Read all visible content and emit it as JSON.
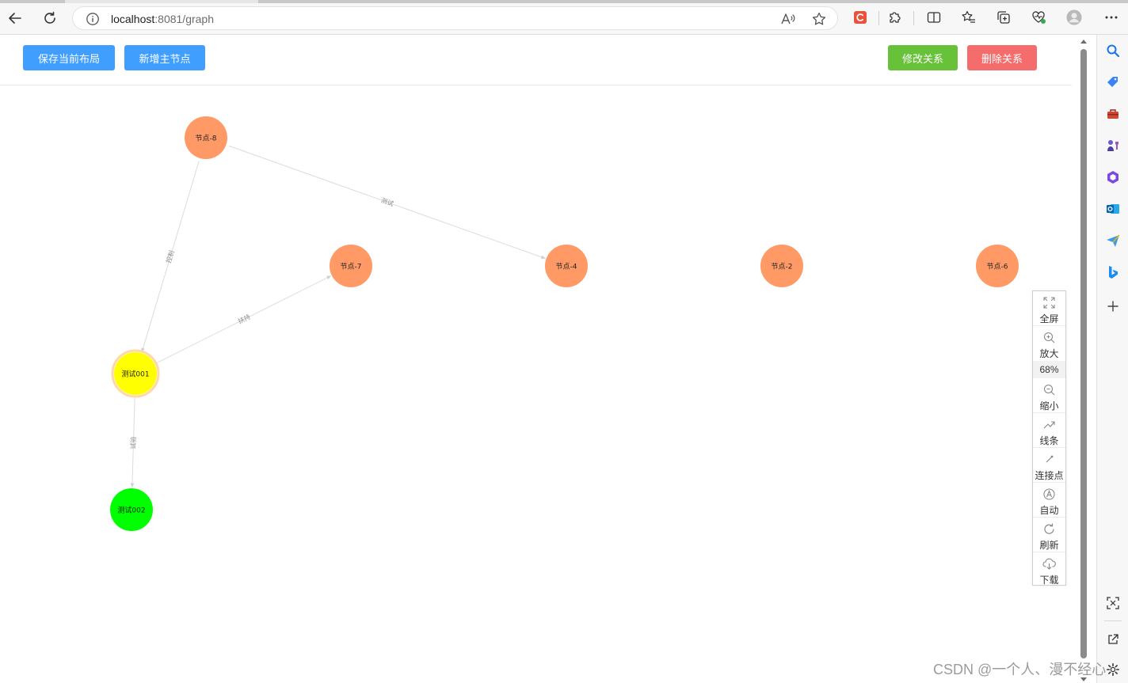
{
  "browser": {
    "url_host": "localhost",
    "url_path": ":8081/graph"
  },
  "toolbar": {
    "save_layout_label": "保存当前布局",
    "add_main_node_label": "新增主节点",
    "edit_relation_label": "修改关系",
    "delete_relation_label": "删除关系"
  },
  "graph": {
    "nodes": [
      {
        "id": "n8",
        "label": "节点-8",
        "color": "#ff9a66"
      },
      {
        "id": "n7",
        "label": "节点-7",
        "color": "#ff9a66"
      },
      {
        "id": "n4",
        "label": "节点-4",
        "color": "#ff9a66"
      },
      {
        "id": "n2",
        "label": "节点-2",
        "color": "#ff9a66"
      },
      {
        "id": "n6",
        "label": "节点-6",
        "color": "#ff9a66"
      },
      {
        "id": "t1",
        "label": "测试001",
        "color": "#ffff00"
      },
      {
        "id": "t2",
        "label": "测试002",
        "color": "#00ff00"
      }
    ],
    "links": [
      {
        "from": "n8",
        "to": "n4",
        "label": "测试"
      },
      {
        "from": "n8",
        "to": "t1",
        "label": "控制"
      },
      {
        "from": "t1",
        "to": "n7",
        "label": "扶持"
      },
      {
        "from": "t1",
        "to": "t2",
        "label": "试验"
      }
    ]
  },
  "tools": {
    "fullscreen": "全屏",
    "zoom_in": "放大",
    "zoom_level": "68%",
    "zoom_out": "缩小",
    "line_style": "线条",
    "connect_point": "连接点",
    "auto": "自动",
    "refresh": "刷新",
    "download": "下载"
  },
  "watermark": "CSDN @一个人、漫不经心",
  "colors": {
    "primary": "#409eff",
    "success": "#67c23a",
    "danger": "#f56c6c",
    "node_default": "#ff9a66"
  }
}
